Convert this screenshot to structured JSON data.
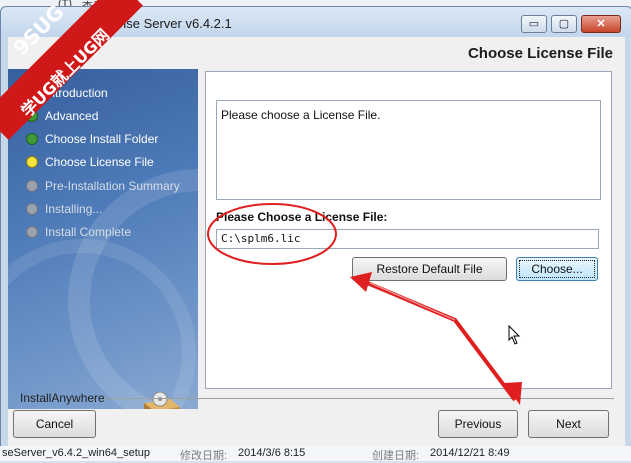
{
  "background": {
    "top_items": [
      "(T)",
      "查看(V)"
    ],
    "status_bar": {
      "filename": "seServer_v6.4.2_win64_setup",
      "modified_label": "修改日期:",
      "modified_value": "2014/3/6 8:15",
      "created_label": "创建日期:",
      "created_value": "2014/12/21 8:49"
    }
  },
  "window": {
    "title": "nse Server v6.4.2.1",
    "controls": {
      "minimize": "▭",
      "maximize": "▢",
      "close": "✕"
    }
  },
  "header": {
    "title": "Choose License File"
  },
  "steps": [
    {
      "label": "Introduction",
      "state": "done"
    },
    {
      "label": "Advanced",
      "state": "done"
    },
    {
      "label": "Choose Install Folder",
      "state": "done"
    },
    {
      "label": "Choose License File",
      "state": "current"
    },
    {
      "label": "Pre-Installation Summary",
      "state": "pending"
    },
    {
      "label": "Installing...",
      "state": "pending"
    },
    {
      "label": "Install Complete",
      "state": "pending"
    }
  ],
  "content": {
    "message": "Please choose a License File.",
    "field_label": "Please Choose a License File:",
    "path_value": "C:\\splm6.lic",
    "restore_label": "Restore Default File",
    "choose_label": "Choose..."
  },
  "footer": {
    "brand": "InstallAnywhere",
    "cancel_label": "Cancel",
    "previous_label": "Previous",
    "next_label": "Next"
  },
  "watermark": {
    "line1": "9SUG",
    "line2": "学UG就上UG网"
  },
  "colors": {
    "annotation_red": "#e02020",
    "watermark_red": "#d01818",
    "accent_blue": "#3c7fb1"
  }
}
